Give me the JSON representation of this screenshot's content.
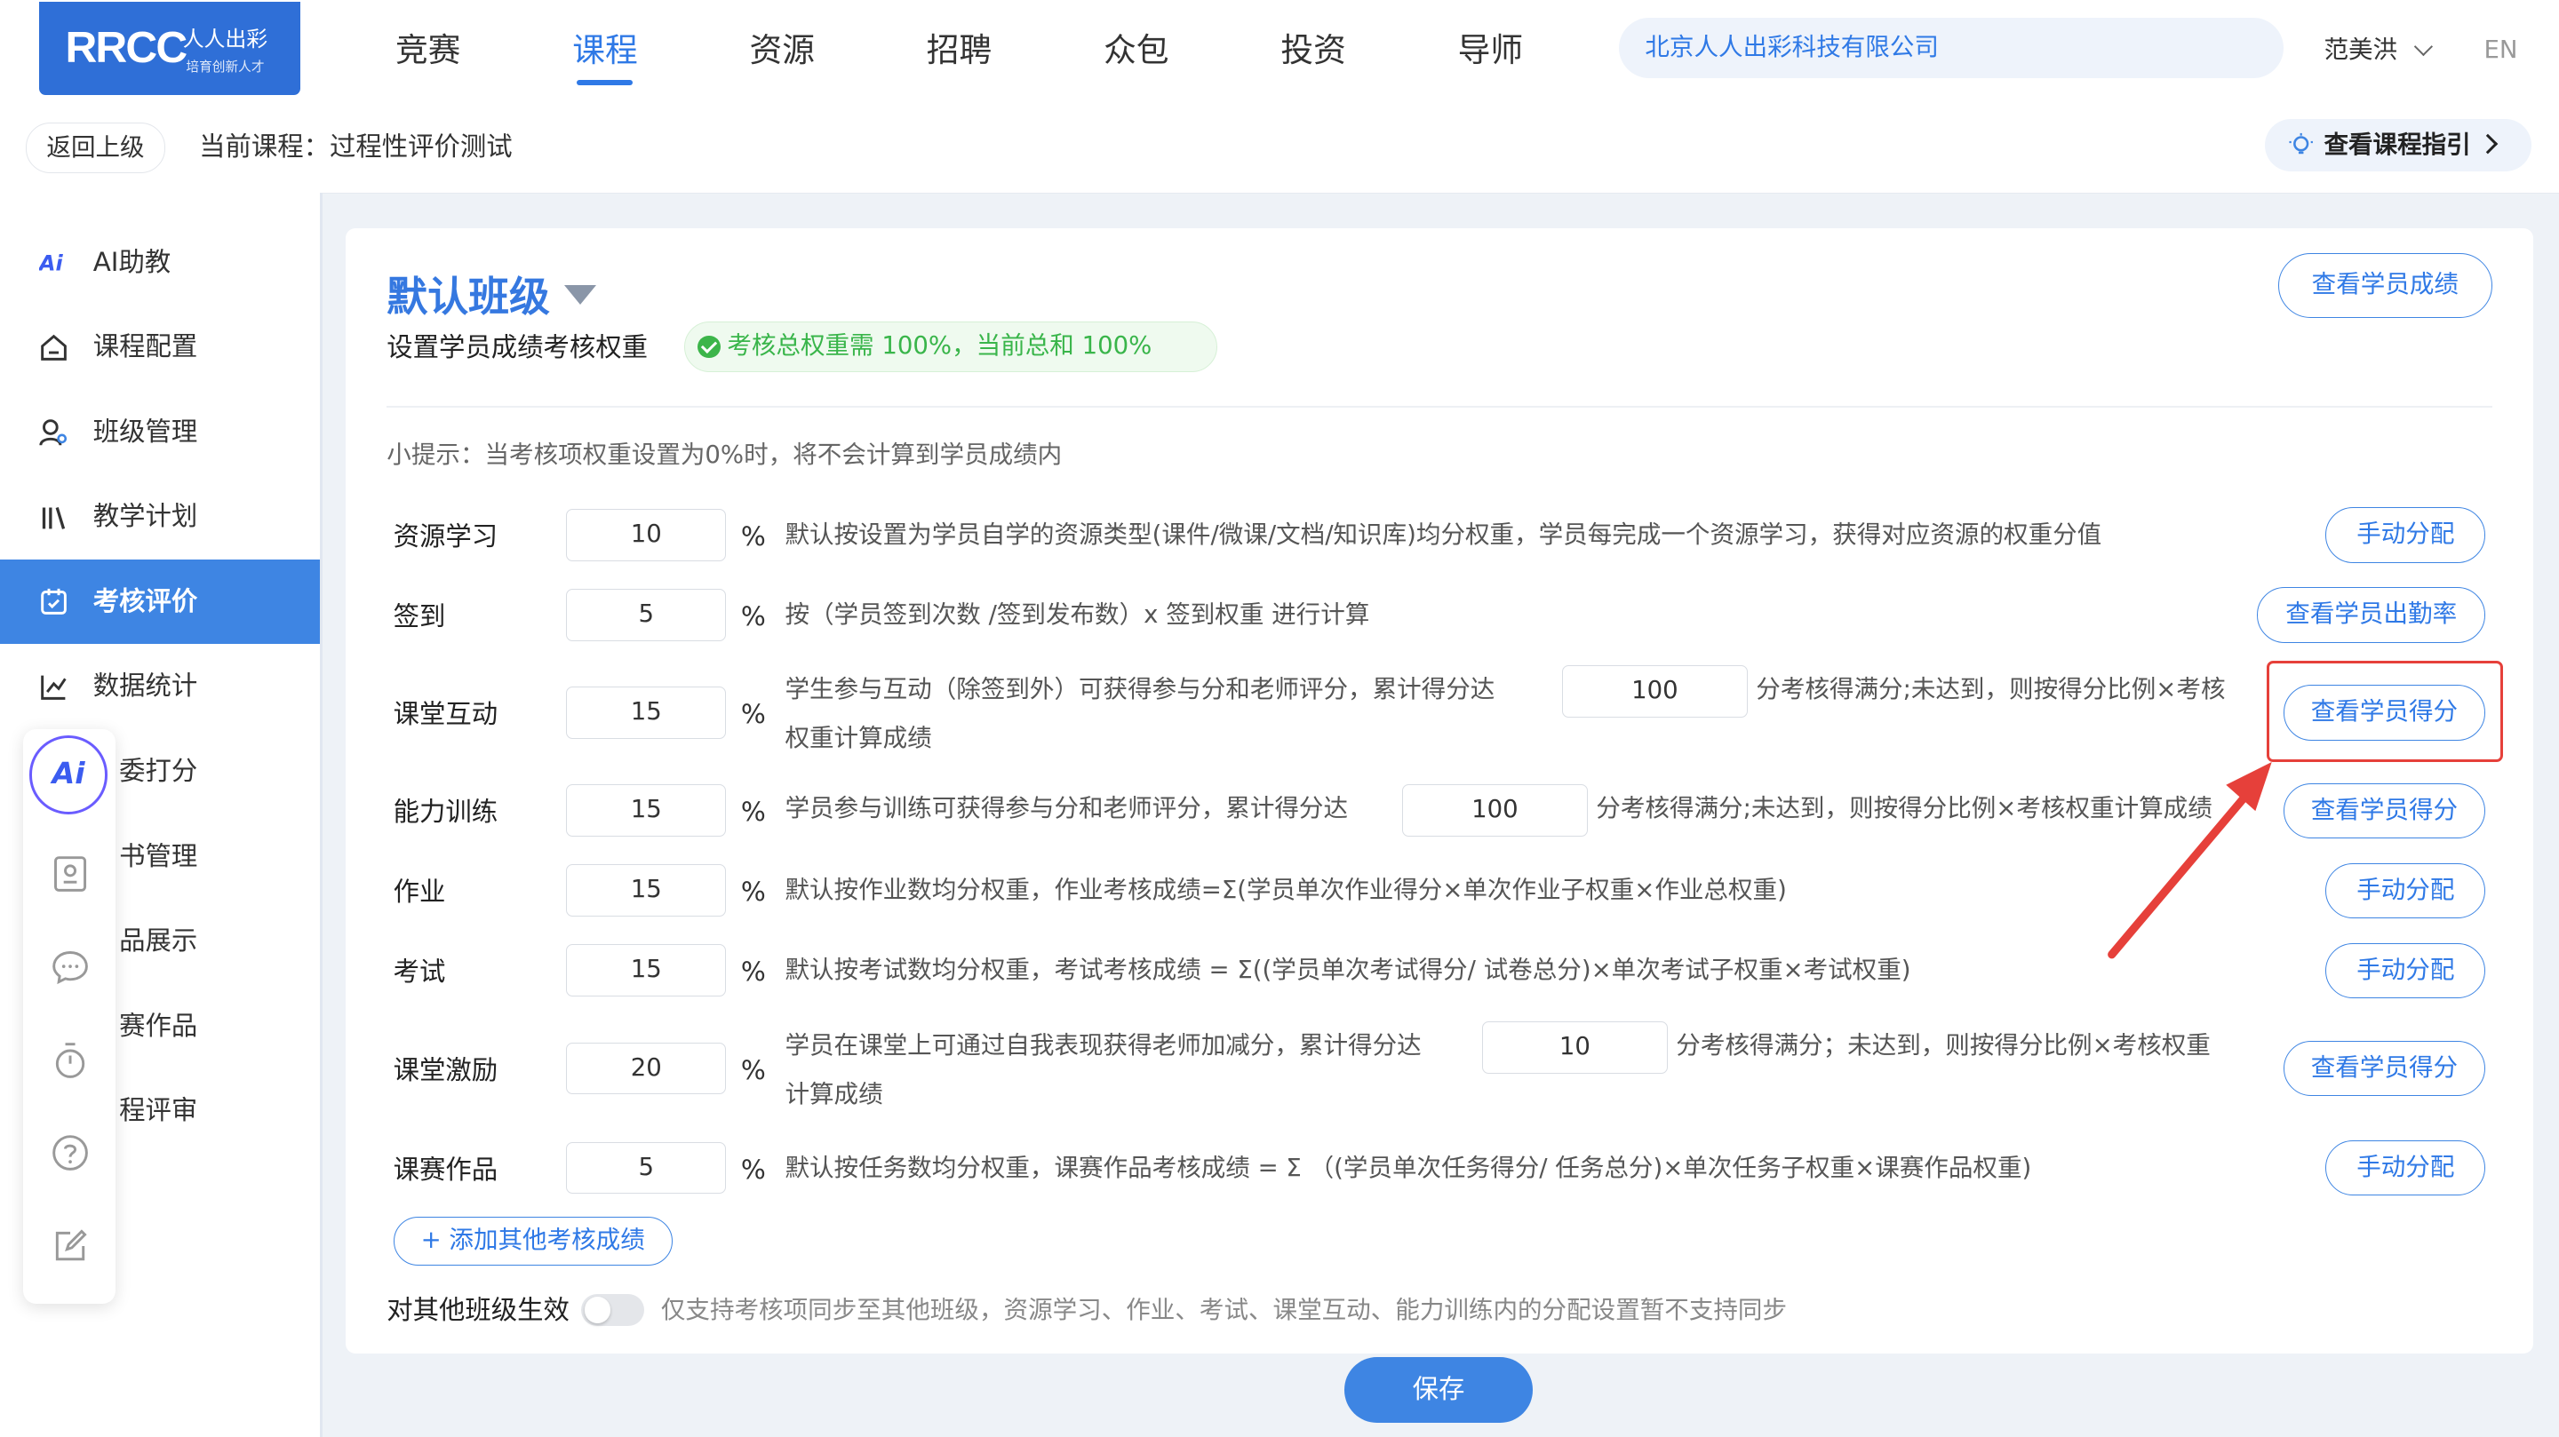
{
  "header": {
    "logo_text": "RRCC",
    "logo_cn": "人人出彩",
    "logo_slogan": "培育创新人才",
    "nav": [
      "竞赛",
      "课程",
      "资源",
      "招聘",
      "众包",
      "投资",
      "导师"
    ],
    "nav_active": "课程",
    "company": "北京人人出彩科技有限公司",
    "user": "范美洪",
    "lang": "EN"
  },
  "subbar": {
    "back": "返回上级",
    "current_course": "当前课程：过程性评价测试",
    "guide": "查看课程指引"
  },
  "sidebar": {
    "items": [
      "AI助教",
      "课程配置",
      "班级管理",
      "教学计划",
      "考核评价",
      "数据统计",
      "委打分",
      "书管理",
      "品展示",
      "赛作品",
      "程评审"
    ],
    "active": "考核评价"
  },
  "main": {
    "class_name": "默认班级",
    "subtitle": "设置学员成绩考核权重",
    "weight_ok": "考核总权重需 100%，当前总和 100%",
    "view_scores": "查看学员成绩",
    "tip": "小提示：当考核项权重设置为0%时，将不会计算到学员成绩内",
    "rows": [
      {
        "label": "资源学习",
        "value": "10",
        "desc": "默认按设置为学员自学的资源类型(课件/微课/文档/知识库)均分权重，学员每完成一个资源学习，获得对应资源的权重分值",
        "button": "手动分配"
      },
      {
        "label": "签到",
        "value": "5",
        "desc": "按（学员签到次数 /签到发布数）x 签到权重 进行计算",
        "button": "查看学员出勤率"
      },
      {
        "label": "课堂互动",
        "value": "15",
        "desc_a": "学生参与互动（除签到外）可获得参与分和老师评分，累计得分达",
        "threshold": "100",
        "desc_b": "分考核得满分;未达到，则按得分比例×考核",
        "desc_c": "权重计算成绩",
        "button": "查看学员得分"
      },
      {
        "label": "能力训练",
        "value": "15",
        "desc_a": "学员参与训练可获得参与分和老师评分，累计得分达",
        "threshold": "100",
        "desc_b": "分考核得满分;未达到，则按得分比例×考核权重计算成绩",
        "button": "查看学员得分"
      },
      {
        "label": "作业",
        "value": "15",
        "desc": "默认按作业数均分权重，作业考核成绩=Σ(学员单次作业得分×单次作业子权重×作业总权重)",
        "button": "手动分配"
      },
      {
        "label": "考试",
        "value": "15",
        "desc": "默认按考试数均分权重，考试考核成绩 = Σ((学员单次考试得分/ 试卷总分)×单次考试子权重×考试权重)",
        "button": "手动分配"
      },
      {
        "label": "课堂激励",
        "value": "20",
        "desc_a": "学员在课堂上可通过自我表现获得老师加减分，累计得分达",
        "threshold": "10",
        "desc_b": "分考核得满分；未达到，则按得分比例×考核权重",
        "desc_c": "计算成绩",
        "button": "查看学员得分"
      },
      {
        "label": "课赛作品",
        "value": "5",
        "desc": "默认按任务数均分权重，课赛作品考核成绩 = Σ （(学员单次任务得分/ 任务总分)×单次任务子权重×课赛作品权重)",
        "button": "手动分配"
      }
    ],
    "pct_unit": "%",
    "add_other": "+ 添加其他考核成绩",
    "sync_label": "对其他班级生效",
    "sync_note": "仅支持考核项同步至其他班级，资源学习、作业、考试、课堂互动、能力训练内的分配设置暂不支持同步",
    "save": "保存"
  },
  "colors": {
    "accent": "#3e85e3",
    "success": "#39b54a",
    "highlight": "#e6403a"
  }
}
